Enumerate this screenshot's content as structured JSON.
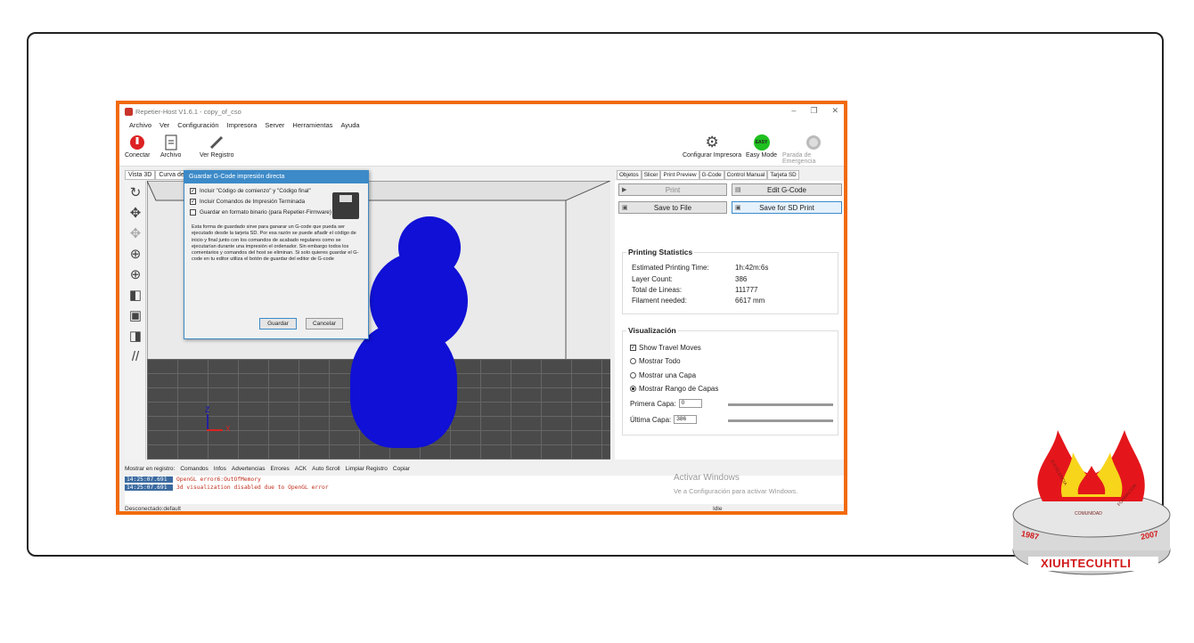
{
  "window": {
    "title": "Repetier-Host V1.6.1 - copy_of_cso"
  },
  "menu": [
    "Archivo",
    "Ver",
    "Configuración",
    "Impresora",
    "Server",
    "Herramientas",
    "Ayuda"
  ],
  "toolbar": {
    "connect": "Conectar",
    "file": "Archivo",
    "log": "Ver Registro",
    "config_printer": "Configurar Impresora",
    "easy_mode": "Easy Mode",
    "easy_badge": "EASY",
    "emergency": "Parada de Emergencia"
  },
  "view_tabs": [
    "Vista 3D",
    "Curva de T"
  ],
  "dialog": {
    "title": "Guardar G-Code impresión directa",
    "options": [
      {
        "label": "Incluir \"Código de comienzo\" y \"Código final\"",
        "checked": true
      },
      {
        "label": "Incluir Comandos de Impresión Terminada",
        "checked": true
      },
      {
        "label": "Guardar en formato binario (para Repetier-Firmware)",
        "checked": false
      }
    ],
    "text": "Esta forma de guardado sirve para ganarar un G-code que pueda ser ejecutado desde la tarjeta SD. Por esa razón se puede añadir el código de inicio y final junto con los comandos de acabado regulares como se ejecutarían durante una impresión el ordenador. Sin embargo todos los comentarios y comandos del host se eliminan. Si solo quieres guardar el G-code en tu editor utiliza el botón de guardar del editor de G-code",
    "save": "Guardar",
    "cancel": "Cancelar"
  },
  "right_tabs": [
    "Objetos",
    "Slicer",
    "Print Preview",
    "G-Code",
    "Control Manual",
    "Tarjeta SD"
  ],
  "actions": {
    "print": "Print",
    "edit_gcode": "Edit G-Code",
    "save_file": "Save to File",
    "save_sd": "Save for SD Print"
  },
  "stats": {
    "title": "Printing Statistics",
    "rows": [
      {
        "label": "Estimated Printing Time:",
        "value": "1h:42m:6s"
      },
      {
        "label": "Layer Count:",
        "value": "386"
      },
      {
        "label": "Total de Lineas:",
        "value": "111777"
      },
      {
        "label": "Filament needed:",
        "value": "6617 mm"
      }
    ]
  },
  "visual": {
    "title": "Visualización",
    "show_travel": "Show Travel Moves",
    "opt_all": "Mostrar Todo",
    "opt_one": "Mostrar una Capa",
    "opt_range": "Mostrar Rango de Capas",
    "first_label": "Primera Capa:",
    "first_value": "0",
    "last_label": "Última Capa:",
    "last_value": "386"
  },
  "logbar": {
    "label": "Mostrar en registro:",
    "items": [
      "Comandos",
      "Infos",
      "Advertencias",
      "Errores",
      "ACK",
      "Auto Scroll",
      "Limpiar Registro",
      "Copiar"
    ]
  },
  "log": [
    {
      "time": "14:25:07.691",
      "msg": "OpenGL error6:OutOfMemory"
    },
    {
      "time": "14:25:07.691",
      "msg": "3d visualization disabled due to OpenGL error"
    }
  ],
  "watermark": {
    "title": "Activar Windows",
    "sub": "Ve a Configuración para activar Windows."
  },
  "status": {
    "left": "Desconectado:default",
    "right": "Idle"
  },
  "axes": {
    "z": "Z",
    "x": "X"
  },
  "logo": {
    "name": "XIUHTECUHTLI",
    "year_left": "1987",
    "year_right": "2007",
    "ring_left": "EXCELENCIA",
    "ring_right": "FORMACION",
    "ring_mid": "COMUNIDAD"
  }
}
